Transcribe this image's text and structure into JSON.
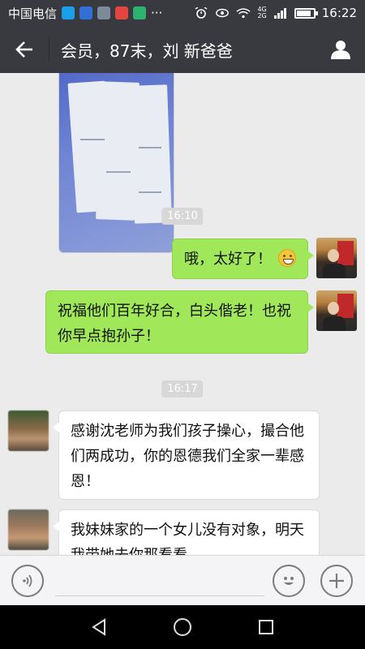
{
  "status_bar": {
    "carrier": "中国电信",
    "network_top": "4G",
    "network_bottom": "2G",
    "time": "16:22",
    "battery_level": 0.85
  },
  "header": {
    "back_icon": "back-arrow-icon",
    "title": "会员，87末，刘  新爸爸",
    "profile_icon": "person-icon"
  },
  "messages": [
    {
      "type": "time",
      "text": "16:10"
    },
    {
      "type": "text",
      "side": "right",
      "text": "哦，太好了！"
    },
    {
      "type": "text",
      "side": "right",
      "text": "祝福他们百年好合，白头偕老！也祝你早点抱孙子！"
    },
    {
      "type": "time",
      "text": "16:17"
    },
    {
      "type": "text",
      "side": "left",
      "text": "感谢沈老师为我们孩子操心，撮合他们两成功，你的恩德我们全家一辈感恩！"
    },
    {
      "type": "text",
      "side": "left",
      "text": "我妹妹家的一个女儿没有对象，明天我带她去你那看看"
    }
  ],
  "input_bar": {
    "voice_icon": "voice-icon",
    "emoji_icon": "emoji-icon",
    "more_icon": "plus-icon",
    "text_value": ""
  },
  "nav": {
    "back_icon": "triangle-back-icon",
    "home_icon": "circle-home-icon",
    "recents_icon": "square-recents-icon"
  },
  "colors": {
    "header_bg": "#393a3f",
    "chat_bg": "#ebebeb",
    "bubble_green": "#a0e75a",
    "bubble_white": "#ffffff"
  }
}
